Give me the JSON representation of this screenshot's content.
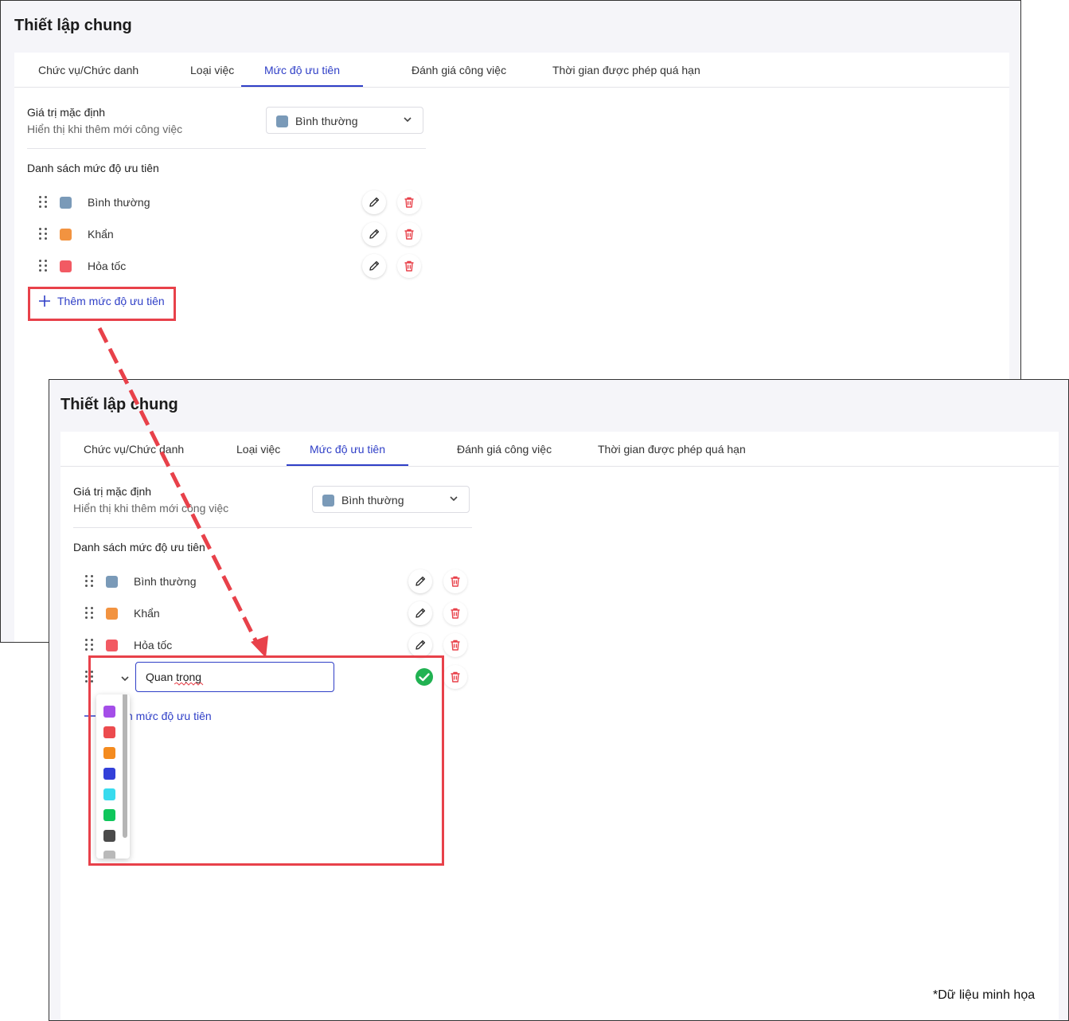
{
  "page": {
    "title": "Thiết lập chung",
    "footnote": "*Dữ liệu minh họa"
  },
  "tabs": [
    {
      "label": "Chức vụ/Chức danh"
    },
    {
      "label": "Loại việc"
    },
    {
      "label": "Mức độ ưu tiên",
      "active": true
    },
    {
      "label": "Đánh giá công việc"
    },
    {
      "label": "Thời gian được phép quá hạn"
    }
  ],
  "default_value": {
    "label": "Giá trị mặc định",
    "sub": "Hiển thị khi thêm mới công việc",
    "selected": "Bình thường",
    "selected_color": "#7a9ab8"
  },
  "list": {
    "title": "Danh sách mức độ ưu tiên",
    "items": [
      {
        "name": "Bình thường",
        "color": "#7a9ab8"
      },
      {
        "name": "Khẩn",
        "color": "#f29340"
      },
      {
        "name": "Hỏa tốc",
        "color": "#f25a63"
      }
    ],
    "add_label": "Thêm mức độ ưu tiên",
    "add_label_partial": "n mức độ ưu tiên"
  },
  "new_item": {
    "value": "Quan trọng"
  },
  "palette": [
    "#a44ee8",
    "#ec4b4e",
    "#f48b1f",
    "#3340d9",
    "#38dbee",
    "#0fc65b",
    "#4a4a4a",
    "#b9b9b9"
  ],
  "colors": {
    "accent": "#2f3fc7",
    "danger": "#e8414a",
    "success": "#21b252"
  }
}
